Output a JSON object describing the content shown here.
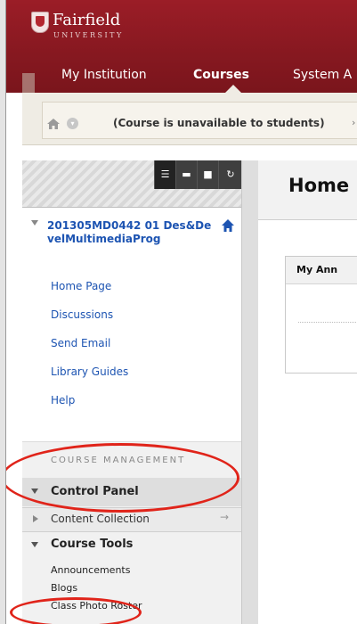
{
  "header": {
    "logo_name": "Fairfield",
    "logo_sub": "UNIVERSITY",
    "nav_tabs": [
      {
        "label": "My Institution"
      },
      {
        "label": "Courses",
        "active": true
      },
      {
        "label": "System A"
      }
    ]
  },
  "breadcrumb": {
    "text": "(Course is unavailable to students)",
    "separator": "›"
  },
  "sidebar": {
    "course_title": "201305MD0442 01 Des&DevelMultimediaProg",
    "menu": [
      {
        "label": "Home Page"
      },
      {
        "label": "Discussions"
      },
      {
        "label": "Send Email"
      },
      {
        "label": "Library Guides"
      },
      {
        "label": "Help"
      }
    ],
    "course_management": {
      "label": "COURSE MANAGEMENT",
      "control_panel": "Control Panel",
      "content_collection": "Content Collection",
      "content_collection_arrow": "→",
      "course_tools": "Course Tools",
      "tools": [
        {
          "label": "Announcements"
        },
        {
          "label": "Blogs"
        },
        {
          "label": "Class Photo Roster"
        }
      ]
    }
  },
  "main": {
    "title": "Home",
    "module_title": "My Ann"
  },
  "colors": {
    "brand": "#8e1a22",
    "link": "#1d54b2",
    "annotation": "#e0241a"
  }
}
